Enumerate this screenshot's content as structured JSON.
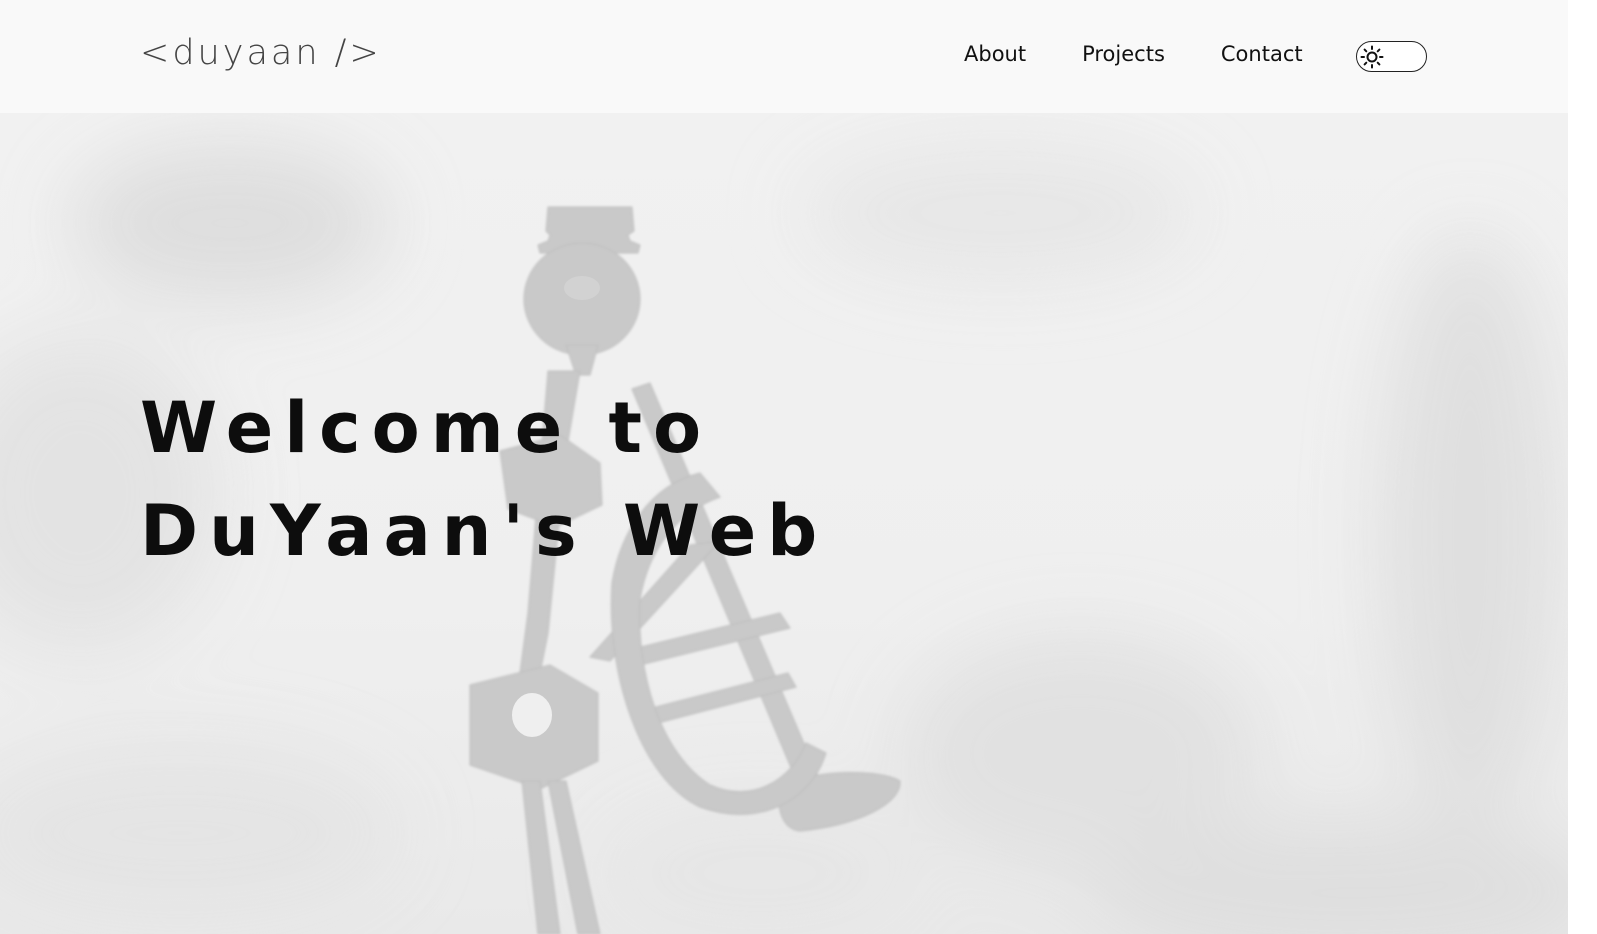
{
  "header": {
    "logo": "<duyaan />",
    "nav": [
      "About",
      "Projects",
      "Contact"
    ],
    "theme_toggle_icon": "sun-icon"
  },
  "hero": {
    "title_line1": "Welcome to",
    "title_line2": "DuYaan's Web",
    "background_image": "trumpet-figurine-photo"
  },
  "colors": {
    "text": "#0d0d0d",
    "header_bg": "#f9f9f9",
    "hero_bg": "#efefef"
  }
}
